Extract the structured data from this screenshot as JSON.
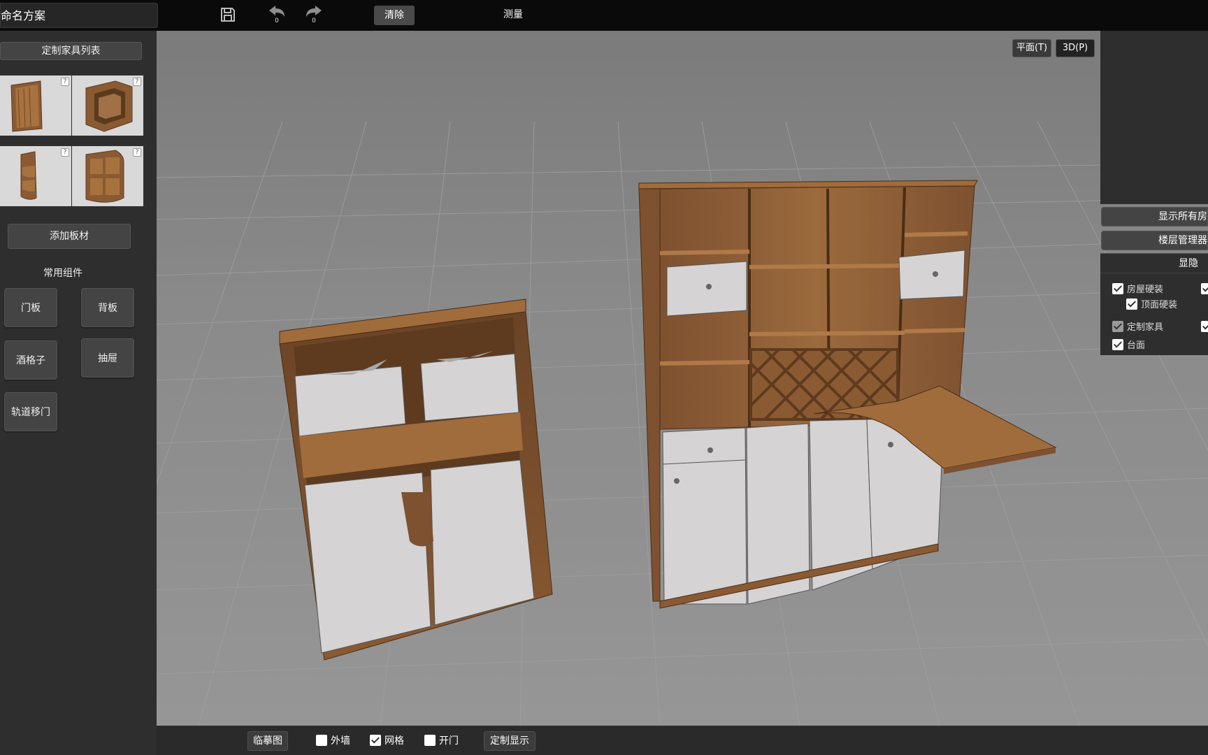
{
  "topbar": {
    "project_name": "命名方案",
    "undo_count": "0",
    "redo_count": "0",
    "clear_label": "清除",
    "measure_label": "测量"
  },
  "leftpanel": {
    "furniture_list_label": "定制家具列表",
    "thumbnails": [
      {
        "name": "cabinet-tall",
        "help": "?"
      },
      {
        "name": "cube-frame",
        "help": "?"
      },
      {
        "name": "corner-round-shelf",
        "help": "?"
      },
      {
        "name": "corner-shelf",
        "help": "?"
      }
    ],
    "add_board_label": "添加板材",
    "common_components_title": "常用组件",
    "components": [
      "门板",
      "背板",
      "酒格子",
      "抽屉",
      "轨道移门"
    ]
  },
  "viewport": {
    "plan_view_label": "平面(T)",
    "view_3d_label": "3D(P)"
  },
  "rightpanel": {
    "show_all_rooms_label": "显示所有房",
    "floor_manager_label": "楼层管理器",
    "visibility_title": "显隐",
    "visibility_items": [
      {
        "label": "房屋硬装",
        "checked": true,
        "disabled": false
      },
      {
        "label": "顶面硬装",
        "checked": true,
        "disabled": false
      },
      {
        "label": "定制家具",
        "checked": true,
        "disabled": true
      },
      {
        "label": "台面",
        "checked": true,
        "disabled": false
      }
    ]
  },
  "bottombar": {
    "trace_image_label": "临摹图",
    "outer_wall_label": "外墙",
    "outer_wall_checked": false,
    "grid_label": "网格",
    "grid_checked": true,
    "open_door_label": "开门",
    "open_door_checked": false,
    "custom_display_label": "定制显示"
  },
  "colors": {
    "wood": "#8a5a32",
    "wood_light": "#a8723f",
    "door_white": "#d8d6d6",
    "panel_bg": "#2e2e2e",
    "topbar_bg": "#0a0a0a"
  }
}
